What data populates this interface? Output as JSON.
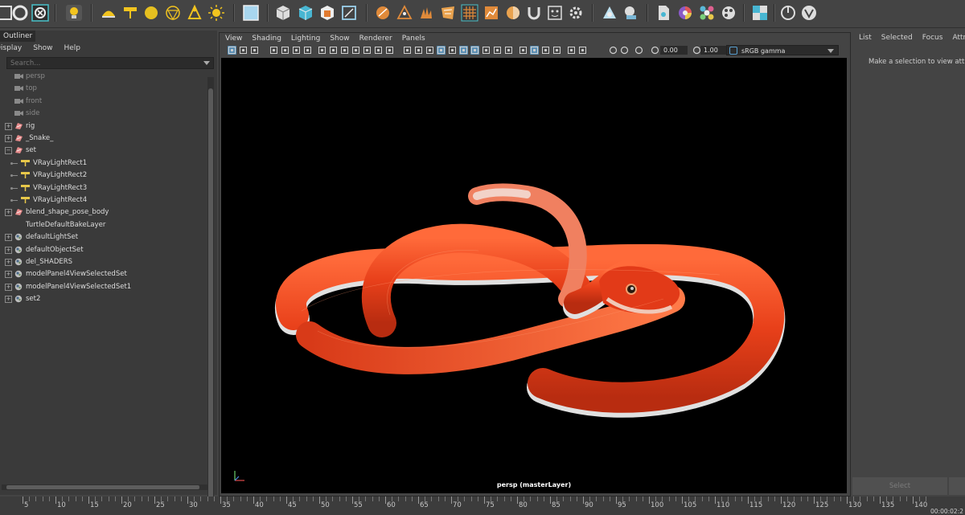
{
  "outliner": {
    "title": "Outliner",
    "menu": [
      "Display",
      "Show",
      "Help"
    ],
    "search_placeholder": "Search...",
    "items": [
      {
        "label": "persp",
        "icon": "camera-icon",
        "dim": true,
        "expander": false
      },
      {
        "label": "top",
        "icon": "camera-icon",
        "dim": true,
        "expander": false
      },
      {
        "label": "front",
        "icon": "camera-icon",
        "dim": true,
        "expander": false
      },
      {
        "label": "side",
        "icon": "camera-icon",
        "dim": true,
        "expander": false
      },
      {
        "label": "rig",
        "icon": "group-icon",
        "dim": false,
        "expander": true
      },
      {
        "label": "_Snake_",
        "icon": "group-icon",
        "dim": false,
        "expander": true
      },
      {
        "label": "set",
        "icon": "group-icon",
        "dim": false,
        "expander": true,
        "expanded": true
      },
      {
        "label": "VRayLightRect1",
        "icon": "light-icon",
        "dim": false,
        "child": true
      },
      {
        "label": "VRayLightRect2",
        "icon": "light-icon",
        "dim": false,
        "child": true
      },
      {
        "label": "VRayLightRect3",
        "icon": "light-icon",
        "dim": false,
        "child": true
      },
      {
        "label": "VRayLightRect4",
        "icon": "light-icon",
        "dim": false,
        "child": true
      },
      {
        "label": "blend_shape_pose_body",
        "icon": "group-icon",
        "dim": false,
        "expander": true
      },
      {
        "label": "TurtleDefaultBakeLayer",
        "icon": "none",
        "dim": false,
        "expander": false
      },
      {
        "label": "defaultLightSet",
        "icon": "set-icon",
        "dim": false,
        "expander": true
      },
      {
        "label": "defaultObjectSet",
        "icon": "set-icon",
        "dim": false,
        "expander": true
      },
      {
        "label": "del_SHADERS",
        "icon": "set-icon",
        "dim": false,
        "expander": true
      },
      {
        "label": "modelPanel4ViewSelectedSet",
        "icon": "set-icon",
        "dim": false,
        "expander": true
      },
      {
        "label": "modelPanel4ViewSelectedSet1",
        "icon": "set-icon",
        "dim": false,
        "expander": true
      },
      {
        "label": "set2",
        "icon": "set-icon",
        "dim": false,
        "expander": true
      }
    ]
  },
  "viewport": {
    "menu": [
      "View",
      "Shading",
      "Lighting",
      "Show",
      "Renderer",
      "Panels"
    ],
    "exposure": "0.00",
    "gamma": "1.00",
    "color_space": "sRGB gamma",
    "camera_label": "persp (masterLayer)"
  },
  "right_panel": {
    "tabs": [
      "List",
      "Selected",
      "Focus",
      "Attribu"
    ],
    "message": "Make a selection to view attrib",
    "select_label": "Select"
  },
  "timeline": {
    "labels": [
      "5",
      "10",
      "15",
      "20",
      "25",
      "30",
      "35",
      "40",
      "45",
      "50",
      "55",
      "60",
      "65",
      "70",
      "75",
      "80",
      "85",
      "90",
      "95",
      "100",
      "105",
      "110",
      "115",
      "120",
      "125",
      "130",
      "135",
      "140"
    ],
    "timecode": "00:00:02:2"
  },
  "shelf_icons": [
    "uv-icon",
    "snap-icon",
    "move-icon",
    "bulb-icon",
    "dome-icon",
    "area-light-icon",
    "sphere-icon",
    "geodesic-icon",
    "spot-icon",
    "sun-icon",
    "render-region-icon",
    "cube-icon",
    "cube-blue-icon",
    "cube-orange-icon",
    "cube-outline-icon",
    "paint-icon",
    "triangle-icon",
    "hand-icon",
    "pattern-icon",
    "grid-icon",
    "chart-icon",
    "sphere-cut-icon",
    "magnet-icon",
    "face-icon",
    "gear-icon",
    "cone-icon",
    "shader-icon",
    "document-icon",
    "color-wheel-icon",
    "palette-icon",
    "palette2-icon",
    "checker-icon",
    "power-icon",
    "vray-icon"
  ]
}
